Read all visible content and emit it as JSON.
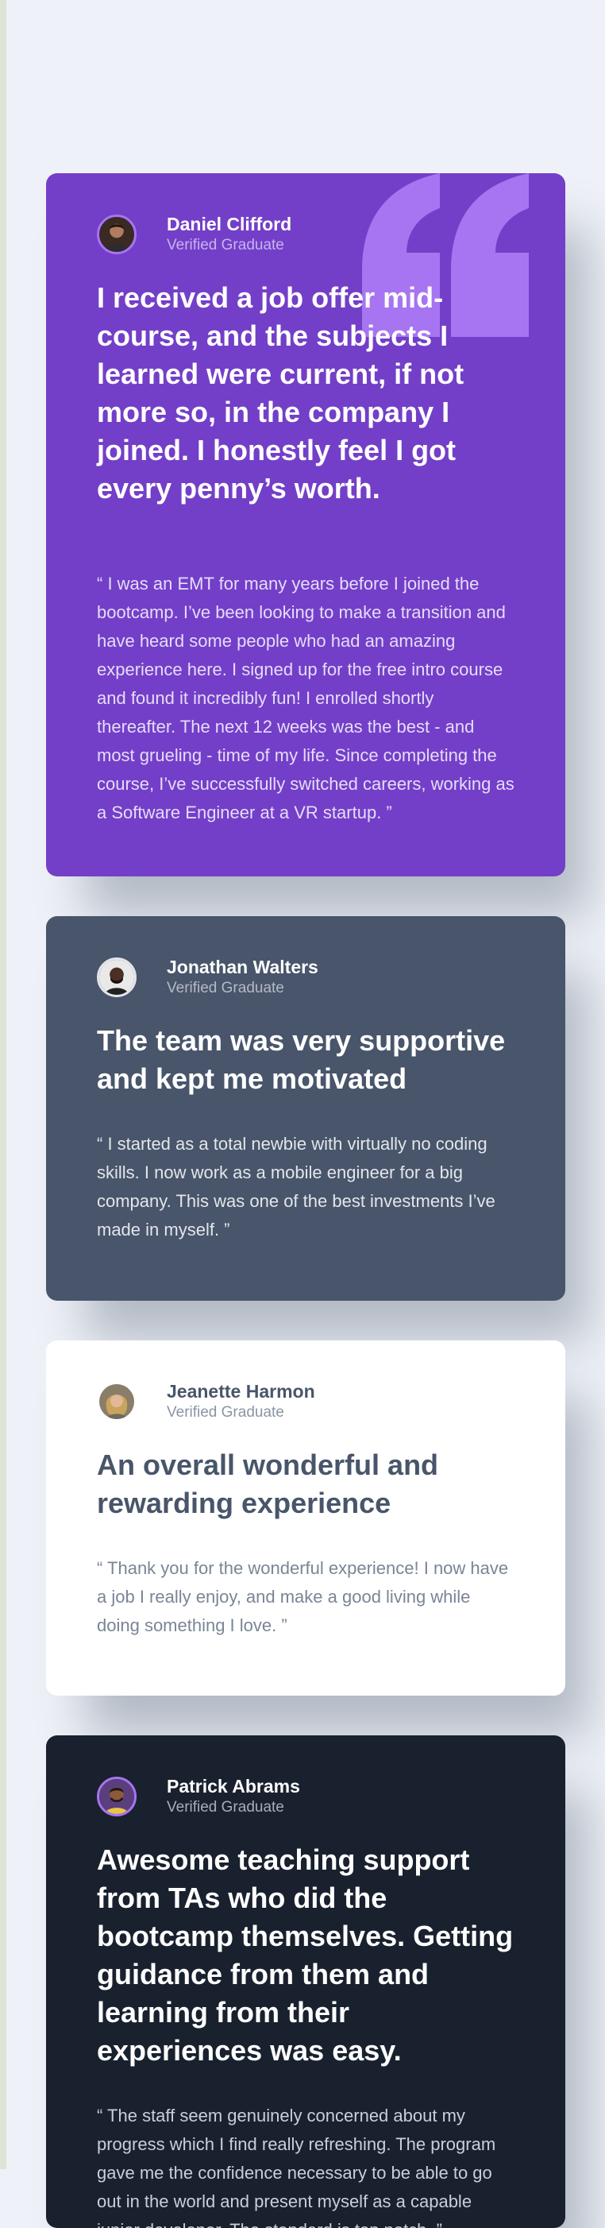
{
  "colors": {
    "purple": "#733fc8",
    "gray": "#48556a",
    "white": "#ffffff",
    "dark": "#19212e",
    "background": "#eef1f7",
    "quote_accent": "#a775f1"
  },
  "testimonials": [
    {
      "name": "Daniel Clifford",
      "role": "Verified Graduate",
      "headline": "I received a job offer mid-course, and the subjects I learned were current, if not more so, in the company I joined. I honestly feel I got every penny’s worth.",
      "body": "“ I was an EMT for many years before I joined the bootcamp. I’ve been looking to make a transition and have heard some people who had an amazing experience here. I signed up for the free intro course and found it incredibly fun! I enrolled shortly thereafter. The next 12 weeks was the best - and most grueling - time of my life. Since completing the course, I’ve successfully switched careers, working as a Software Engineer at a VR startup. ”",
      "avatar_icon": "avatar-daniel-icon"
    },
    {
      "name": "Jonathan Walters",
      "role": "Verified Graduate",
      "headline": "The team was very supportive and kept me motivated",
      "body": "“ I started as a total newbie with virtually no coding skills. I now work as a mobile engineer for a big company. This was one of the best investments I’ve made in myself. ”",
      "avatar_icon": "avatar-jonathan-icon"
    },
    {
      "name": "Jeanette Harmon",
      "role": "Verified Graduate",
      "headline": "An overall wonderful and rewarding experience",
      "body": "“ Thank you for the wonderful experience! I now have a job I really enjoy, and make a good living while doing something I love. ”",
      "avatar_icon": "avatar-jeanette-icon"
    },
    {
      "name": "Patrick Abrams",
      "role": "Verified Graduate",
      "headline": "Awesome teaching support from TAs who did the bootcamp themselves. Getting guidance from them and learning from their experiences was easy.",
      "body": "“ The staff seem genuinely concerned about my progress which I find really refreshing. The program gave me the confidence necessary to be able to go out in the world and present myself as a capable junior developer. The standard is top notch. ”",
      "avatar_icon": "avatar-patrick-icon"
    }
  ]
}
